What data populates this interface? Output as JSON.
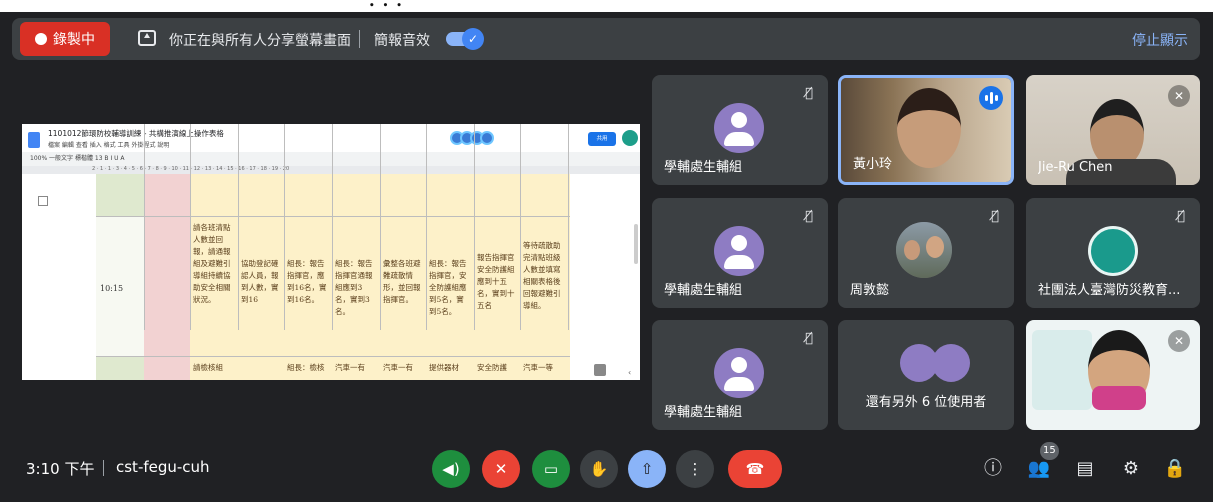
{
  "caption": "...",
  "topbar": {
    "record_label": "錄製中",
    "share_text": "你正在與所有人分享螢幕畫面",
    "sound_label": "簡報音效",
    "stop_label": "停止顯示"
  },
  "shared_doc": {
    "title": "1101012節環防校輔導訓練 - 共構推演線上操作表格",
    "menu": "檔案 編輯 查看 插入 格式 工具 外掛程式 說明",
    "toolbar": "100%  一般文字  標楷體  13  B I U A",
    "share_btn": "共用",
    "time": "10:15",
    "cells": [
      "請各班清點人數並回報，請通報組及避難引導組持續協助安全相關狀況。",
      "協助登記確認人員，報到人數，實到16",
      "組長：報告指揮官，應到16名，實到16名。",
      "組長：報告指揮官通報組應到3名，實到3名。",
      "彙整各班避難疏散情形，並回報指揮官。",
      "組長：報告指揮官，安全防護組應到5名，實到5名。",
      "報告指揮官安全防護組應到十五名，實到十五名",
      "等待疏散助完清點班級人數並填寫相關表格後回報避難引導組。"
    ],
    "row2": [
      "請檢核組",
      "組長：檢核",
      "汽車一有",
      "汽車一有",
      "提供器材",
      "安全防護",
      "汽車一等"
    ]
  },
  "participants": [
    {
      "name": "學輔處生輔組",
      "type": "avatar",
      "muted": true
    },
    {
      "name": "黃小玲",
      "type": "video",
      "speaking": true
    },
    {
      "name": "Jie-Ru Chen",
      "type": "video",
      "muted": true
    },
    {
      "name": "學輔處生輔組",
      "type": "avatar",
      "muted": true
    },
    {
      "name": "周敦懿",
      "type": "photo",
      "muted": true
    },
    {
      "name": "社團法人臺灣防災教育...",
      "type": "logo",
      "muted": true
    },
    {
      "name": "學輔處生輔組",
      "type": "avatar",
      "muted": true
    },
    {
      "name": "",
      "type": "video",
      "muted": true
    }
  ],
  "others": {
    "text": "還有另外 6 位使用者"
  },
  "bottombar": {
    "time": "3:10 下午",
    "meeting_code": "cst-fegu-cuh",
    "people_count": "15"
  },
  "colors": {
    "background": "#202124",
    "tile": "#3c4043",
    "record": "#d93025",
    "accent": "#8ab4f8",
    "green": "#1e8e3e",
    "red": "#ea4335"
  },
  "icons": [
    "record-dot-icon",
    "present-icon",
    "toggle-check-icon",
    "mic-off-icon",
    "speaking-icon",
    "mic-icon",
    "camera-icon",
    "raise-hand-icon",
    "present-now-icon",
    "more-options-icon",
    "hang-up-icon",
    "info-icon",
    "people-icon",
    "chat-icon",
    "activities-icon",
    "host-controls-icon"
  ]
}
